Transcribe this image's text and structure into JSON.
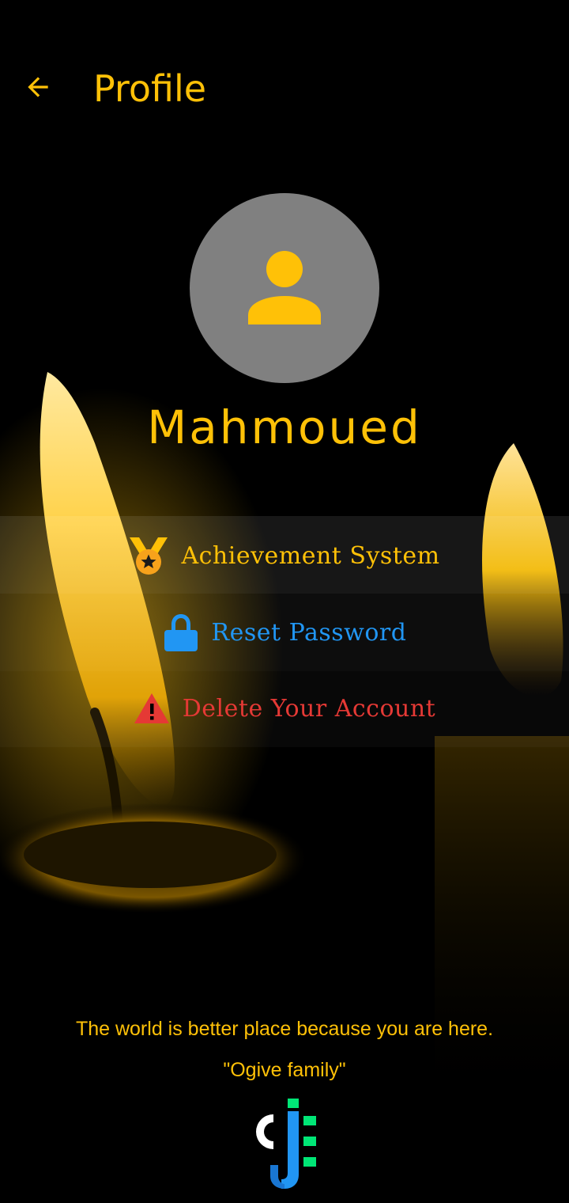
{
  "header": {
    "title": "Profile",
    "back_icon": "arrow-left-icon"
  },
  "profile": {
    "avatar_icon": "person-icon",
    "username": "Mahmoued"
  },
  "menu": [
    {
      "label": "Achievement System",
      "icon": "medal-icon",
      "color": "#FFC107"
    },
    {
      "label": "Reset Password",
      "icon": "lock-icon",
      "color": "#2196F3"
    },
    {
      "label": "Delete Your Account",
      "icon": "warning-icon",
      "color": "#E53935"
    }
  ],
  "footer": {
    "quote_line": "The world is better place because you are here.",
    "signature": "\"Ogive family\"",
    "logo_icon": "ogive-logo-icon"
  },
  "colors": {
    "accent": "#FFC107",
    "avatar_bg": "#808080",
    "background": "#000000"
  }
}
